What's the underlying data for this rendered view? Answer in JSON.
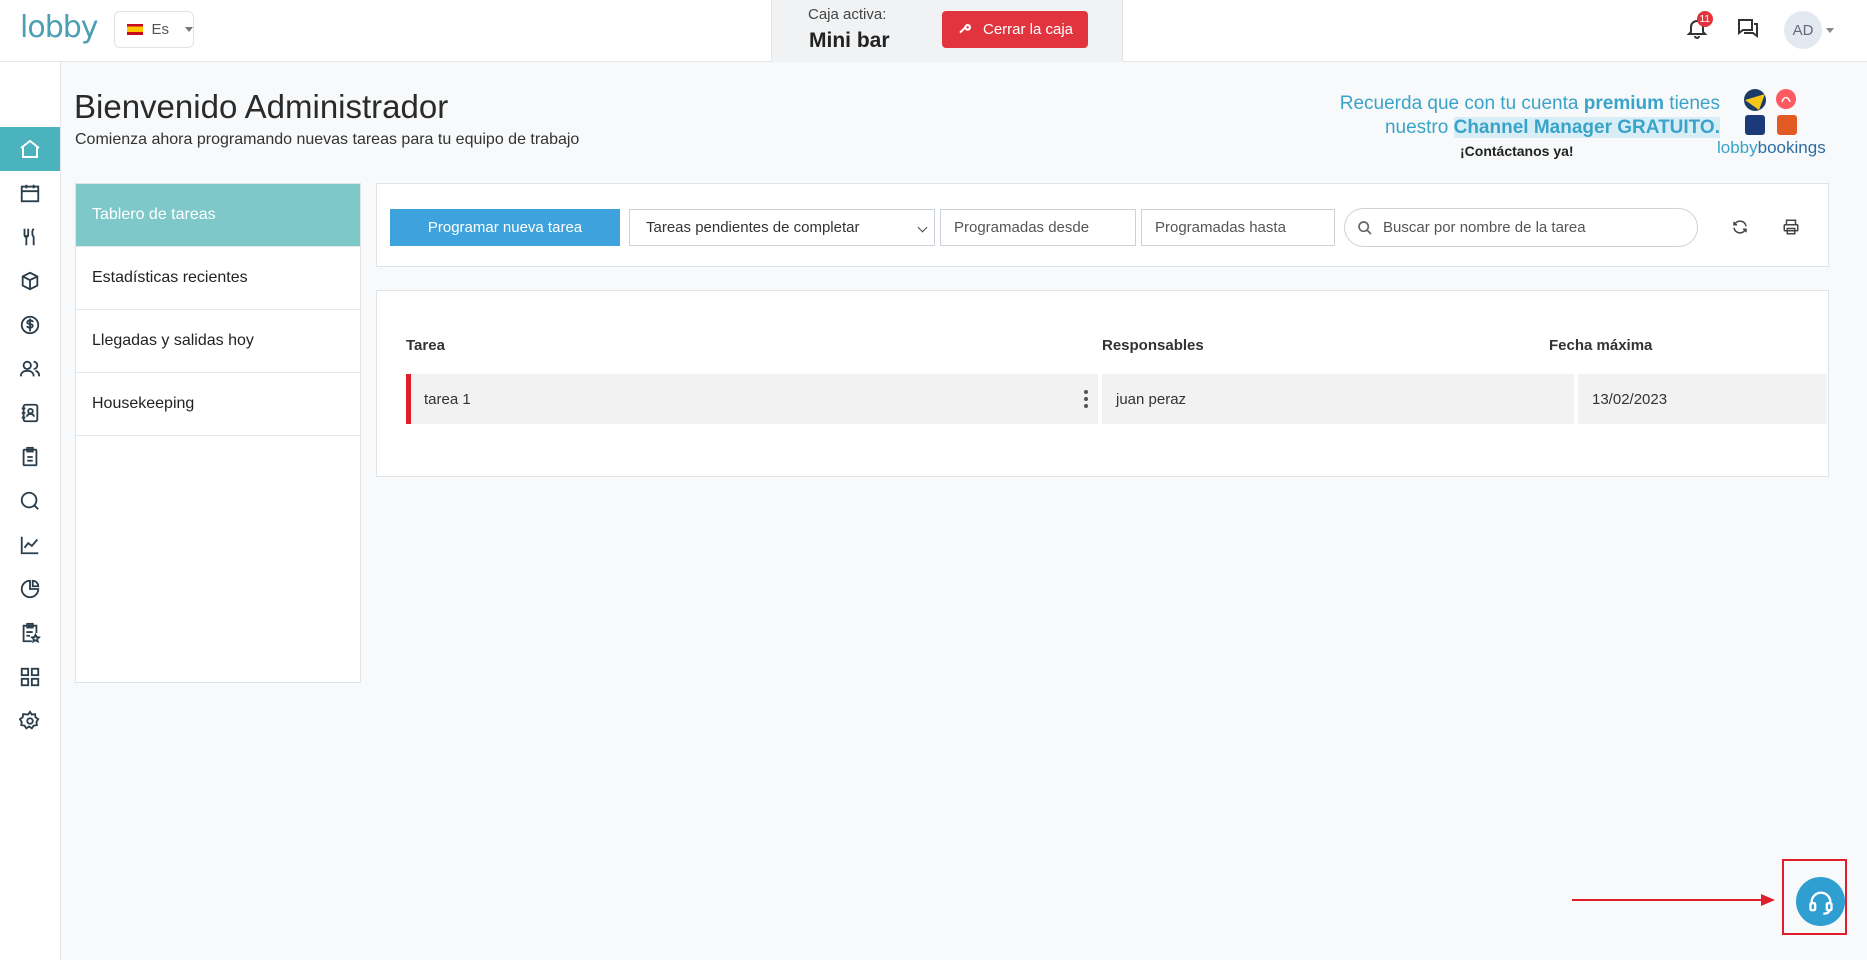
{
  "app": {
    "logo": "lobby"
  },
  "language": {
    "code": "Es"
  },
  "caja": {
    "label": "Caja activa:",
    "name": "Mini bar",
    "close_label": "Cerrar la caja"
  },
  "notifications": {
    "count": "11"
  },
  "user": {
    "initials": "AD"
  },
  "sidebar": {
    "items": [
      {
        "icon": "home-icon",
        "active": true
      },
      {
        "icon": "calendar-icon"
      },
      {
        "icon": "restaurant-icon"
      },
      {
        "icon": "box-icon"
      },
      {
        "icon": "dollar-icon"
      },
      {
        "icon": "users-icon"
      },
      {
        "icon": "contacts-book-icon"
      },
      {
        "icon": "clipboard-icon"
      },
      {
        "icon": "search-icon"
      },
      {
        "icon": "line-chart-icon"
      },
      {
        "icon": "pie-chart-icon"
      },
      {
        "icon": "clipboard-star-icon"
      },
      {
        "icon": "grid-icon"
      },
      {
        "icon": "settings-icon"
      }
    ]
  },
  "header": {
    "title": "Bienvenido Administrador",
    "subtitle": "Comienza ahora programando nuevas tareas para tu equipo de trabajo"
  },
  "promo": {
    "line1_prefix": "Recuerda que con tu cuenta ",
    "line1_bold": "premium",
    "line1_suffix": " tienes",
    "line2_prefix": "nuestro ",
    "line2_highlight": "Channel Manager GRATUITO.",
    "cta": "¡Contáctanos ya!",
    "brand_a": "lobby",
    "brand_b": "bookings"
  },
  "menu": {
    "items": [
      {
        "label": "Tablero de tareas",
        "active": true
      },
      {
        "label": "Estadísticas recientes"
      },
      {
        "label": "Llegadas y salidas hoy"
      },
      {
        "label": "Housekeeping"
      }
    ]
  },
  "toolbar": {
    "new_task_label": "Programar nueva tarea",
    "filter_selected": "Tareas pendientes de completar",
    "from_placeholder": "Programadas desde",
    "to_placeholder": "Programadas hasta",
    "search_placeholder": "Buscar por nombre de la tarea"
  },
  "table": {
    "columns": [
      "Tarea",
      "Responsables",
      "Fecha máxima"
    ],
    "rows": [
      {
        "task": "tarea 1",
        "responsible": "juan peraz",
        "due": "13/02/2023",
        "priority_color": "#e01e2b"
      }
    ]
  },
  "colors": {
    "accent": "#4ab3bd",
    "primary_button": "#3ea2dc",
    "danger": "#e2343f",
    "help": "#2f9fd2"
  }
}
